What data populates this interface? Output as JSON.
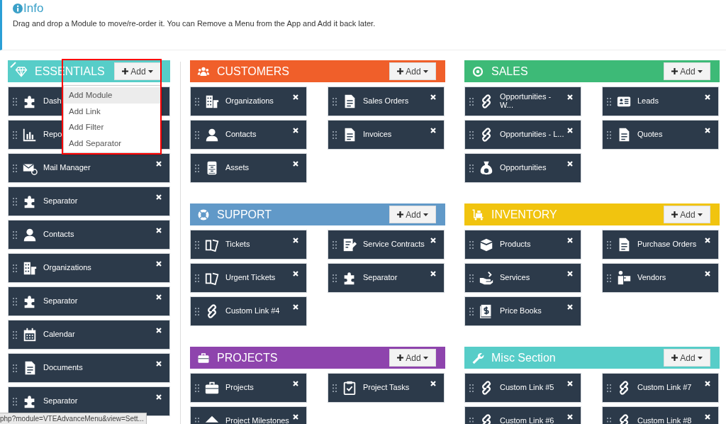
{
  "info": {
    "title": "Info",
    "text": "Drag and drop a Module to move/re-order it. You can Remove a Menu from the App and Add it back later."
  },
  "essentials": {
    "title": "ESSENTIALS",
    "color": "#57cdc8",
    "add_label": "Add",
    "menu_open": true,
    "menu": [
      {
        "label": "Add Module",
        "selected": true
      },
      {
        "label": "Add Link",
        "selected": false
      },
      {
        "label": "Add Filter",
        "selected": false
      },
      {
        "label": "Add Separator",
        "selected": false
      }
    ],
    "items": [
      {
        "label": "Dash"
      },
      {
        "label": "Repo"
      },
      {
        "label": "Mail Manager"
      },
      {
        "label": "Separator"
      },
      {
        "label": "Contacts"
      },
      {
        "label": "Organizations"
      },
      {
        "label": "Separator"
      },
      {
        "label": "Calendar"
      },
      {
        "label": "Documents"
      },
      {
        "label": "Separator"
      }
    ]
  },
  "sections": [
    {
      "title": "CUSTOMERS",
      "color": "#f05f2a",
      "add_label": "Add",
      "items": [
        {
          "label": "Organizations"
        },
        {
          "label": "Sales Orders"
        },
        {
          "label": "Contacts"
        },
        {
          "label": "Invoices"
        },
        {
          "label": "Assets"
        }
      ]
    },
    {
      "title": "SALES",
      "color": "#3dba77",
      "add_label": "Add",
      "items": [
        {
          "label": "Opportunities - W..."
        },
        {
          "label": "Leads"
        },
        {
          "label": "Opportunities - L..."
        },
        {
          "label": "Quotes"
        },
        {
          "label": "Opportunities"
        }
      ]
    },
    {
      "title": "SUPPORT",
      "color": "#6199c8",
      "add_label": "Add",
      "items": [
        {
          "label": "Tickets"
        },
        {
          "label": "Service Contracts"
        },
        {
          "label": "Urgent Tickets"
        },
        {
          "label": "Separator"
        },
        {
          "label": "Custom Link #4"
        }
      ]
    },
    {
      "title": "INVENTORY",
      "color": "#f1c40f",
      "add_label": "Add",
      "items": [
        {
          "label": "Products"
        },
        {
          "label": "Purchase Orders"
        },
        {
          "label": "Services"
        },
        {
          "label": "Vendors"
        },
        {
          "label": "Price Books"
        }
      ]
    },
    {
      "title": "PROJECTS",
      "color": "#8e44ad",
      "add_label": "Add",
      "items": [
        {
          "label": "Projects"
        },
        {
          "label": "Project Tasks"
        },
        {
          "label": "Project Milestones"
        }
      ]
    },
    {
      "title": "Misc Section",
      "color": "#57cdc8",
      "add_label": "Add",
      "items": [
        {
          "label": "Custom Link #5"
        },
        {
          "label": "Custom Link #7"
        },
        {
          "label": "Custom Link #6"
        },
        {
          "label": "Custom Link #8"
        }
      ]
    }
  ],
  "status_bar": {
    "url": "php?module=VTEAdvanceMenu&view=Sett..."
  }
}
